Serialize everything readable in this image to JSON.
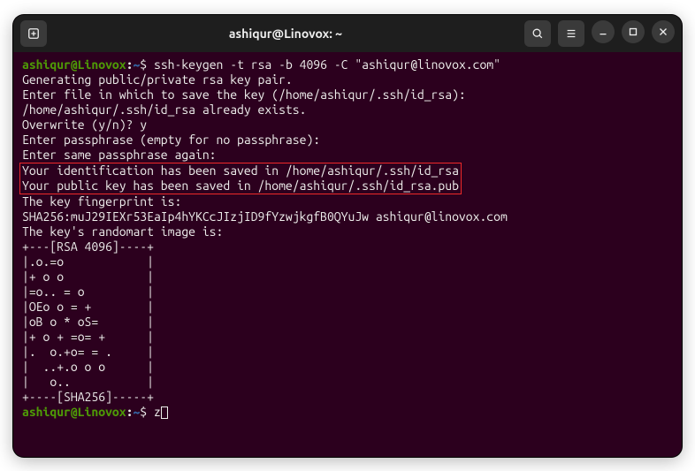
{
  "titlebar": {
    "title": "ashiqur@Linovox: ~"
  },
  "prompt": {
    "user_host": "ashiqur@Linovox",
    "colon": ":",
    "path": "~",
    "symbol": "$ "
  },
  "lines": {
    "cmd1": "ssh-keygen -t rsa -b 4096 -C \"ashiqur@linovox.com\"",
    "l2": "Generating public/private rsa key pair.",
    "l3": "Enter file in which to save the key (/home/ashiqur/.ssh/id_rsa):",
    "l4": "/home/ashiqur/.ssh/id_rsa already exists.",
    "l5": "Overwrite (y/n)? y",
    "l6": "Enter passphrase (empty for no passphrase):",
    "l7": "Enter same passphrase again:",
    "h1": "Your identification has been saved in /home/ashiqur/.ssh/id_rsa",
    "h2": "Your public key has been saved in /home/ashiqur/.ssh/id_rsa.pub",
    "l10": "The key fingerprint is:",
    "l11": "SHA256:muJ29IEXr53EaIp4hYKCcJIzjID9fYzwjkgfB0QYuJw ashiqur@linovox.com",
    "l12": "The key's randomart image is:",
    "r1": "+---[RSA 4096]----+",
    "r2": "|.o.=o            |",
    "r3": "|+ o o            |",
    "r4": "|=o.. = o         |",
    "r5": "|OEo o = +        |",
    "r6": "|oB o * oS=       |",
    "r7": "|+ o + =o= +      |",
    "r8": "|.  o.+o= = .     |",
    "r9": "|  ..+.o o o      |",
    "r10": "|   o..           |",
    "r11": "+----[SHA256]-----+",
    "cmd2": "z"
  }
}
